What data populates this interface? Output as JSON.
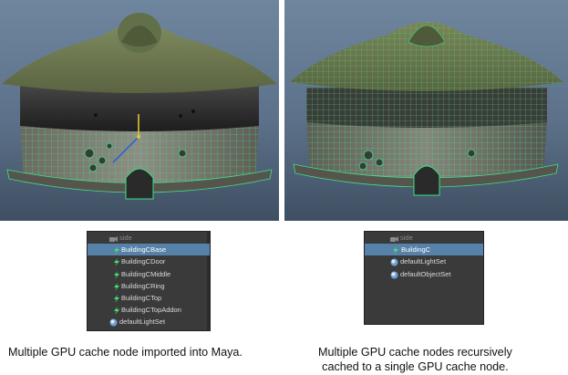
{
  "left_panel": {
    "outliner": {
      "rows": [
        {
          "label": "side",
          "icon": "camera-icon",
          "state": "faded"
        },
        {
          "label": "BuildingCBase",
          "icon": "gpu-cache-icon",
          "state": "selected"
        },
        {
          "label": "BuildingCDoor",
          "icon": "gpu-cache-icon",
          "state": "normal"
        },
        {
          "label": "BuildingCMiddle",
          "icon": "gpu-cache-icon",
          "state": "normal"
        },
        {
          "label": "BuildingCRing",
          "icon": "gpu-cache-icon",
          "state": "normal"
        },
        {
          "label": "BuildingCTop",
          "icon": "gpu-cache-icon",
          "state": "normal"
        },
        {
          "label": "BuildingCTopAddon",
          "icon": "gpu-cache-icon",
          "state": "normal"
        },
        {
          "label": "defaultLightSet",
          "icon": "set-icon",
          "state": "normal"
        }
      ]
    },
    "caption": "Multiple GPU cache node imported into Maya."
  },
  "right_panel": {
    "outliner": {
      "rows": [
        {
          "label": "side",
          "icon": "camera-icon",
          "state": "faded"
        },
        {
          "label": "BuildingC",
          "icon": "gpu-cache-icon",
          "state": "selected"
        },
        {
          "label": "defaultLightSet",
          "icon": "set-icon",
          "state": "normal"
        },
        {
          "label": "defaultObjectSet",
          "icon": "set-icon",
          "state": "normal"
        }
      ]
    },
    "caption_line1": "Multiple GPU cache nodes recursively",
    "caption_line2": "cached to a single GPU cache node."
  },
  "colors": {
    "wireframe": "#3fe08a",
    "roof": "#6e7a52",
    "selection": "#5681a8",
    "outliner_bg": "#3a3a3a"
  }
}
